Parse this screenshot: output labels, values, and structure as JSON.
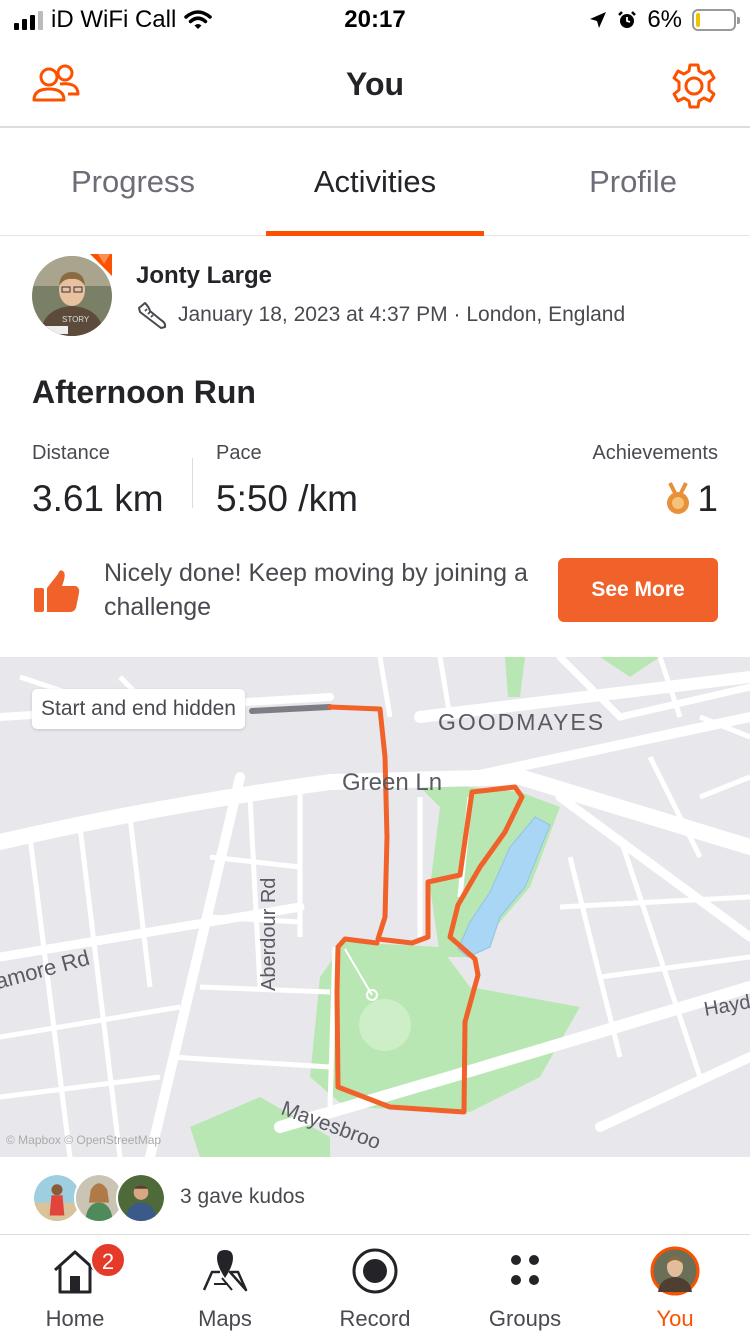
{
  "status_bar": {
    "carrier": "iD WiFi Call",
    "time": "20:17",
    "battery": "6%",
    "battery_level": 0.06
  },
  "header": {
    "title": "You"
  },
  "tabs": [
    {
      "label": "Progress"
    },
    {
      "label": "Activities"
    },
    {
      "label": "Profile"
    }
  ],
  "activity": {
    "athlete": "Jonty Large",
    "meta": "January 18, 2023 at 4:37 PM · London, England",
    "title": "Afternoon Run",
    "stats": {
      "distance_label": "Distance",
      "distance": "3.61 km",
      "pace_label": "Pace",
      "pace": "5:50 /km",
      "achievements_label": "Achievements",
      "achievements": "1"
    },
    "challenge_text": "Nicely done! Keep moving by joining a challenge",
    "see_more": "See More"
  },
  "map": {
    "hidden_label": "Start and end hidden",
    "labels": {
      "area": "GOODMAYES",
      "green_ln": "Green Ln",
      "aberdour": "Aberdour Rd",
      "more_rd": "amore Rd",
      "mayesbrook": "Mayesbroo",
      "hayd": "Hayd"
    },
    "attribution": "© Mapbox © OpenStreetMap",
    "route_color": "#f0622a",
    "park_color": "#b9e7b4",
    "lake_color": "#a9d6f5"
  },
  "kudos": {
    "text": "3 gave kudos"
  },
  "nav": [
    {
      "label": "Home",
      "badge": "2",
      "icon": "home-icon"
    },
    {
      "label": "Maps",
      "icon": "map-icon"
    },
    {
      "label": "Record",
      "icon": "record-icon"
    },
    {
      "label": "Groups",
      "icon": "groups-icon"
    },
    {
      "label": "You",
      "icon": "avatar"
    }
  ],
  "colors": {
    "accent": "#fc5200",
    "button": "#f0622a"
  }
}
